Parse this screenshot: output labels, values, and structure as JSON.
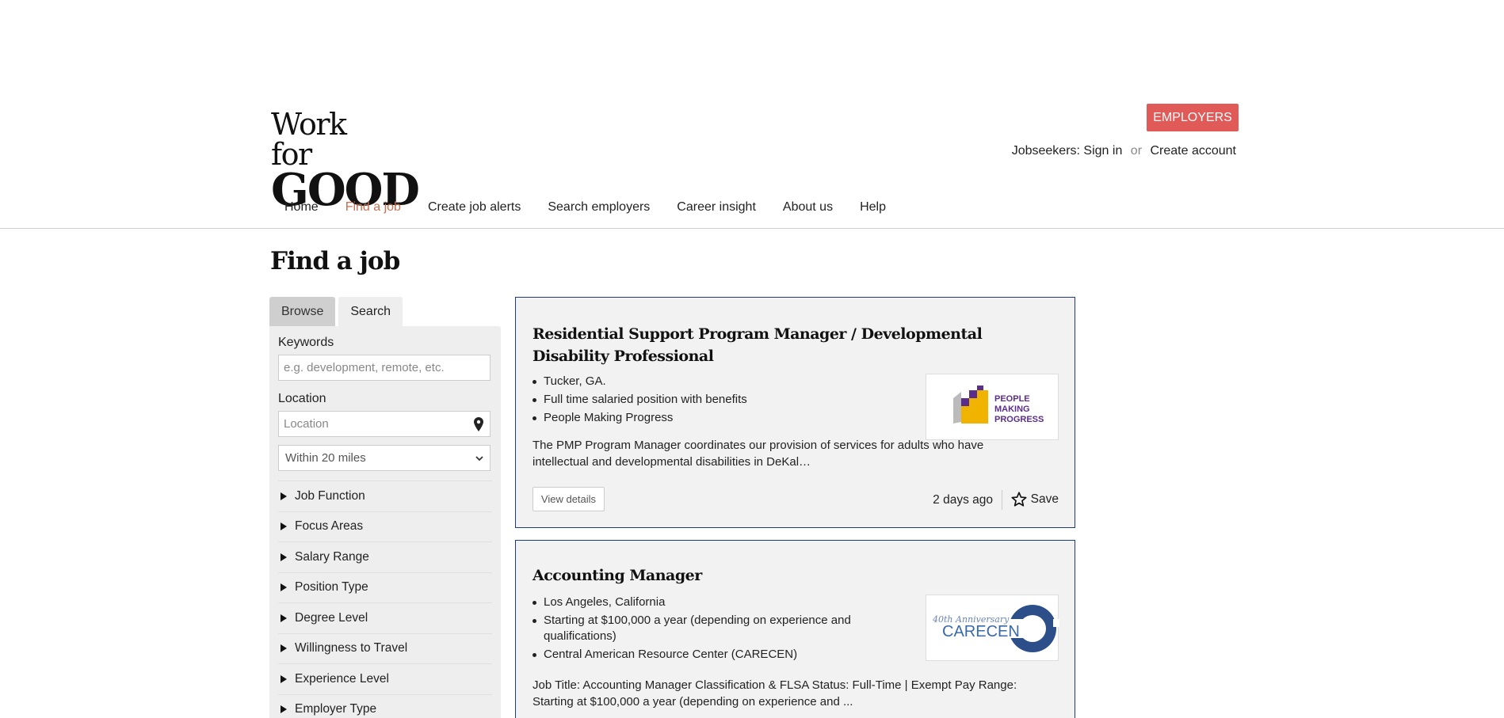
{
  "header": {
    "logo_line1": "Work for",
    "logo_line2": "GOOD",
    "employers_label": "EMPLOYERS",
    "jobseekers_label": "Jobseekers:",
    "sign_in": "Sign in",
    "or": "or",
    "create_account": "Create account"
  },
  "nav": {
    "items": [
      "Home",
      "Find a job",
      "Create job alerts",
      "Search employers",
      "Career insight",
      "About us",
      "Help"
    ],
    "active": "Find a job"
  },
  "page": {
    "title": "Find a job"
  },
  "sidebar": {
    "tabs": [
      "Browse",
      "Search"
    ],
    "keywords_label": "Keywords",
    "keywords_placeholder": "e.g. development, remote, etc.",
    "location_label": "Location",
    "location_placeholder": "Location",
    "distance_value": "Within 20 miles",
    "facets": [
      "Job Function",
      "Focus Areas",
      "Salary Range",
      "Position Type",
      "Degree Level",
      "Willingness to Travel",
      "Experience Level",
      "Employer Type"
    ]
  },
  "jobs": [
    {
      "title": "Residential Support Program Manager / Developmental Disability Professional",
      "location": "Tucker, GA.",
      "salary": "Full time salaried position with benefits",
      "employer": "People Making Progress",
      "description": "The PMP Program Manager coordinates our provision of services for adults who have intellectual and developmental disabilities in DeKal…",
      "view_label": "View details",
      "posted": "2 days ago",
      "save_label": "Save",
      "logo_text": [
        "PEOPLE",
        "MAKING",
        "PROGRESS"
      ]
    },
    {
      "title": "Accounting Manager",
      "location": "Los Angeles, California",
      "salary": "Starting at $100,000 a year (depending on experience and qualifications)",
      "employer": "Central American Resource Center (CARECEN)",
      "description": "Job Title: Accounting Manager Classification & FLSA Status: Full-Time | Exempt Pay Range: Starting at $100,000 a year (depending on experience and ...",
      "logo_text": [
        "40th Anniversary",
        "CARECEN"
      ]
    }
  ],
  "colors": {
    "accent": "#e05a57",
    "nav_active": "#c76f52",
    "card_border": "#1f3a7a"
  }
}
